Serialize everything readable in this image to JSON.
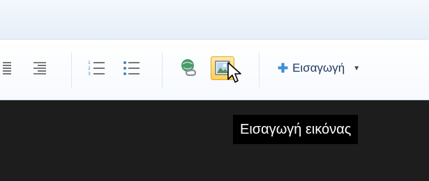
{
  "toolbar": {
    "buttons": [
      {
        "name": "align-justify",
        "icon": "align-justify-icon"
      },
      {
        "name": "align-right",
        "icon": "align-right-icon"
      },
      {
        "name": "numbered-list",
        "icon": "numbered-list-icon"
      },
      {
        "name": "bulleted-list",
        "icon": "bulleted-list-icon"
      },
      {
        "name": "insert-link",
        "icon": "globe-link-icon"
      },
      {
        "name": "insert-image",
        "icon": "image-icon",
        "state": "hover"
      }
    ],
    "insert_label": "Εισαγωγή",
    "insert_icon": "plus-icon"
  },
  "tooltip": {
    "text": "Εισαγωγή εικόνας"
  },
  "colors": {
    "hover_fill": "#ffcf5a",
    "tooltip_bg": "#000000",
    "dark_area": "#1d1d1d",
    "accent": "#3d8fd3"
  }
}
